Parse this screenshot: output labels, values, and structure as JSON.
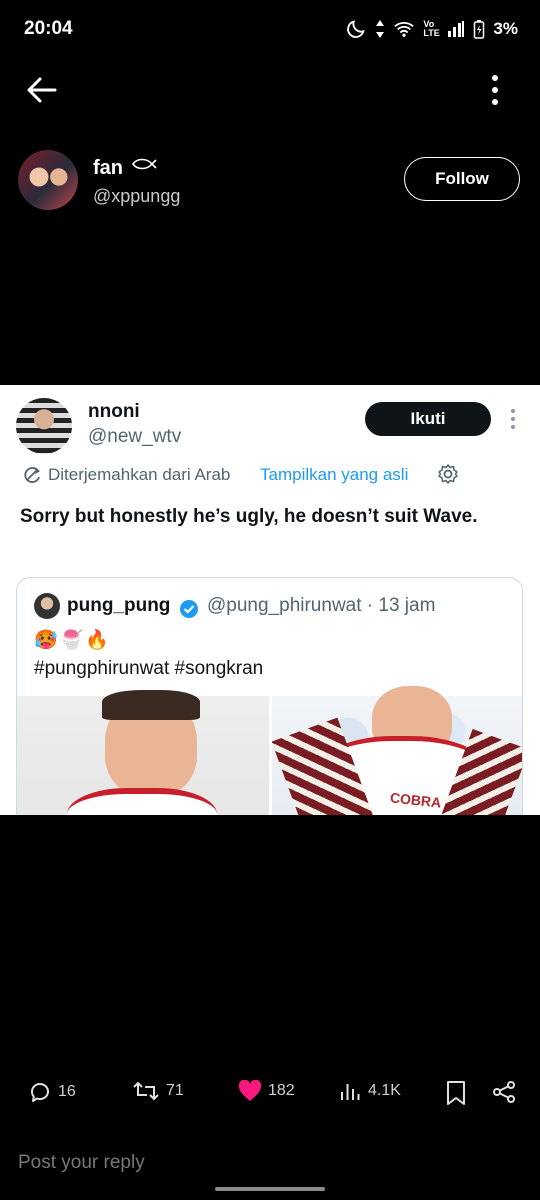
{
  "status_bar": {
    "time": "20:04",
    "network": "Vo LTE",
    "battery": "3%",
    "icons": [
      "moon-icon",
      "data-arrows-icon",
      "wifi-icon",
      "signal-icon",
      "battery-icon"
    ]
  },
  "top_bar": {
    "back_icon": "back-arrow-icon",
    "more_icon": "more-vertical-icon"
  },
  "author": {
    "name": "fan",
    "name_badge": "fish-icon",
    "handle": "@xppungg",
    "follow_label": "Follow"
  },
  "embedded_screenshot": {
    "user": {
      "name": "nnoni",
      "handle": "@new_wtv",
      "follow_label": "Ikuti"
    },
    "translation": {
      "note": "Diterjemahkan dari Arab",
      "show_original": "Tampilkan yang asli"
    },
    "text": "Sorry but honestly he’s ugly, he doesn’t suit Wave.",
    "quote": {
      "name": "pung_pung",
      "verified": true,
      "handle_time": "@pung_phirunwat · 13 jam",
      "emojis": "🥵🍧🔥",
      "text": "#pungphirunwat #songkran",
      "image_caption": "COBRA"
    }
  },
  "actions": {
    "replies": "16",
    "reposts": "71",
    "likes": "182",
    "views": "4.1K",
    "like_color": "#f91880"
  },
  "reply_placeholder": "Post your reply"
}
